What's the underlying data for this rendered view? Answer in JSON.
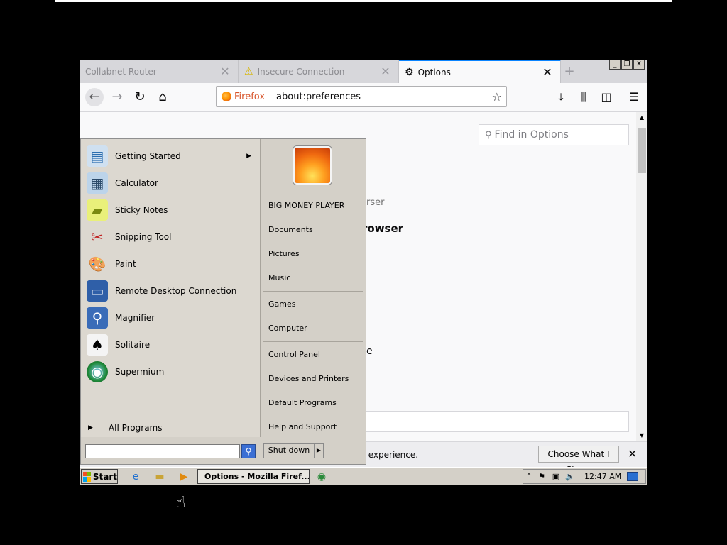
{
  "browser": {
    "tabs": [
      {
        "label": "Collabnet Router",
        "icon": ""
      },
      {
        "label": "Insecure Connection",
        "icon": "warning-icon"
      },
      {
        "label": "Options",
        "icon": "gear-icon"
      }
    ],
    "identity_label": "Firefox",
    "url": "about:preferences",
    "find_placeholder": "Find in Options",
    "content_fragments": [
      "rser",
      "rowser",
      "e"
    ],
    "notification": {
      "text": "r experience.",
      "button": "Choose What I Share"
    }
  },
  "start_menu": {
    "programs": [
      {
        "label": "Getting Started",
        "icon": "getting-started-icon",
        "submenu": true
      },
      {
        "label": "Calculator",
        "icon": "calculator-icon"
      },
      {
        "label": "Sticky Notes",
        "icon": "sticky-notes-icon"
      },
      {
        "label": "Snipping Tool",
        "icon": "snipping-tool-icon"
      },
      {
        "label": "Paint",
        "icon": "paint-icon"
      },
      {
        "label": "Remote Desktop Connection",
        "icon": "remote-desktop-icon"
      },
      {
        "label": "Magnifier",
        "icon": "magnifier-icon"
      },
      {
        "label": "Solitaire",
        "icon": "solitaire-icon"
      },
      {
        "label": "Supermium",
        "icon": "supermium-icon"
      }
    ],
    "all_programs": "All Programs",
    "user_name": "BIG MONEY PLAYER",
    "right_items": [
      "Documents",
      "Pictures",
      "Music",
      "Games",
      "Computer",
      "Control Panel",
      "Devices and Printers",
      "Default Programs",
      "Help and Support"
    ],
    "shutdown_label": "Shut down"
  },
  "taskbar": {
    "start_label": "Start",
    "task_label": "Options - Mozilla Firef...",
    "clock": "12:47 AM"
  }
}
